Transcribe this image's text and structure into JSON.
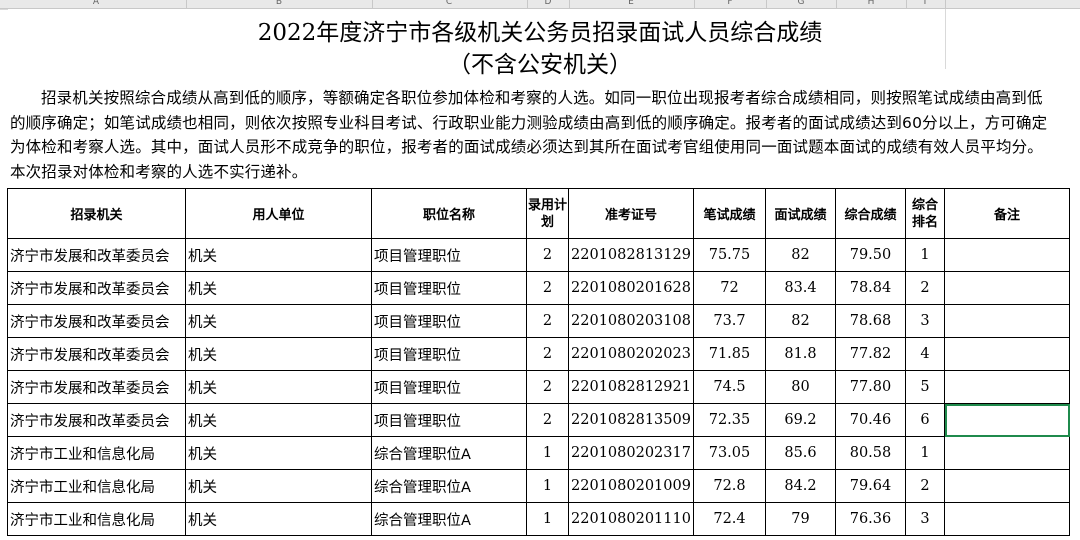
{
  "column_letters": [
    "A",
    "B",
    "C",
    "D",
    "E",
    "F",
    "G",
    "H",
    "I"
  ],
  "title": "2022年度济宁市各级机关公务员招录面试人员综合成绩",
  "subtitle": "（不含公安机关）",
  "note": "招录机关按照综合成绩从高到低的顺序，等额确定各职位参加体检和考察的人选。如同一职位出现报考者综合成绩相同，则按照笔试成绩由高到低的顺序确定；如笔试成绩也相同，则依次按照专业科目考试、行政职业能力测验成绩由高到低的顺序确定。报考者的面试成绩达到60分以上，方可确定为体检和考察人选。其中，面试人员形不成竞争的职位，报考者的面试成绩必须达到其所在面试考官组使用同一面试题本面试的成绩有效人员平均分。本次招录对体检和考察的人选不实行递补。",
  "headers": {
    "agency": "招录机关",
    "unit": "用人单位",
    "position": "职位名称",
    "plan": "录用计划",
    "exam_no": "准考证号",
    "written": "笔试成绩",
    "interview": "面试成绩",
    "total": "综合成绩",
    "rank": "综合排名",
    "remark": "备注"
  },
  "rows": [
    {
      "agency": "济宁市发展和改革委员会",
      "unit": "机关",
      "position": "项目管理职位",
      "plan": "2",
      "exam_no": "2201082813129",
      "written": "75.75",
      "interview": "82",
      "total": "79.50",
      "rank": "1",
      "remark": ""
    },
    {
      "agency": "济宁市发展和改革委员会",
      "unit": "机关",
      "position": "项目管理职位",
      "plan": "2",
      "exam_no": "2201080201628",
      "written": "72",
      "interview": "83.4",
      "total": "78.84",
      "rank": "2",
      "remark": ""
    },
    {
      "agency": "济宁市发展和改革委员会",
      "unit": "机关",
      "position": "项目管理职位",
      "plan": "2",
      "exam_no": "2201080203108",
      "written": "73.7",
      "interview": "82",
      "total": "78.68",
      "rank": "3",
      "remark": ""
    },
    {
      "agency": "济宁市发展和改革委员会",
      "unit": "机关",
      "position": "项目管理职位",
      "plan": "2",
      "exam_no": "2201080202023",
      "written": "71.85",
      "interview": "81.8",
      "total": "77.82",
      "rank": "4",
      "remark": ""
    },
    {
      "agency": "济宁市发展和改革委员会",
      "unit": "机关",
      "position": "项目管理职位",
      "plan": "2",
      "exam_no": "2201082812921",
      "written": "74.5",
      "interview": "80",
      "total": "77.80",
      "rank": "5",
      "remark": ""
    },
    {
      "agency": "济宁市发展和改革委员会",
      "unit": "机关",
      "position": "项目管理职位",
      "plan": "2",
      "exam_no": "2201082813509",
      "written": "72.35",
      "interview": "69.2",
      "total": "70.46",
      "rank": "6",
      "remark": ""
    },
    {
      "agency": "济宁市工业和信息化局",
      "unit": "机关",
      "position": "综合管理职位A",
      "plan": "1",
      "exam_no": "2201080202317",
      "written": "73.05",
      "interview": "85.6",
      "total": "80.58",
      "rank": "1",
      "remark": ""
    },
    {
      "agency": "济宁市工业和信息化局",
      "unit": "机关",
      "position": "综合管理职位A",
      "plan": "1",
      "exam_no": "2201080201009",
      "written": "72.8",
      "interview": "84.2",
      "total": "79.64",
      "rank": "2",
      "remark": ""
    },
    {
      "agency": "济宁市工业和信息化局",
      "unit": "机关",
      "position": "综合管理职位A",
      "plan": "1",
      "exam_no": "2201080201110",
      "written": "72.4",
      "interview": "79",
      "total": "76.36",
      "rank": "3",
      "remark": ""
    }
  ]
}
